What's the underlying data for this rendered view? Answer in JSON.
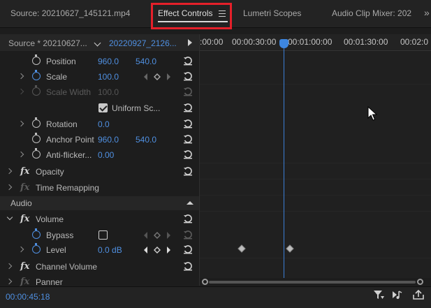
{
  "tabs": {
    "source": "Source: 20210627_145121.mp4",
    "effect_controls": "Effect Controls",
    "lumetri": "Lumetri Scopes",
    "audio_mixer": "Audio Clip Mixer: 202"
  },
  "source_row": {
    "source_label": "Source * 20210627...",
    "sequence_label": "20220927_2126..."
  },
  "ruler": {
    "labels": [
      ":00:00",
      "00:00:30:00",
      "00:01:00:00",
      "00:01:30:00",
      "00:02:0"
    ]
  },
  "properties": {
    "position": {
      "label": "Position",
      "x": "960.0",
      "y": "540.0"
    },
    "scale": {
      "label": "Scale",
      "value": "100.0"
    },
    "scale_width": {
      "label": "Scale Width",
      "value": "100.0"
    },
    "uniform_scale": {
      "label": "Uniform Sc..."
    },
    "rotation": {
      "label": "Rotation",
      "value": "0.0"
    },
    "anchor_point": {
      "label": "Anchor Point",
      "x": "960.0",
      "y": "540.0"
    },
    "anti_flicker": {
      "label": "Anti-flicker...",
      "value": "0.00"
    },
    "opacity": {
      "label": "Opacity"
    },
    "time_remapping": {
      "label": "Time Remapping"
    },
    "audio_section": {
      "label": "Audio"
    },
    "volume": {
      "label": "Volume"
    },
    "bypass": {
      "label": "Bypass"
    },
    "level": {
      "label": "Level",
      "value": "0.0 dB"
    },
    "channel_volume": {
      "label": "Channel Volume"
    },
    "panner": {
      "label": "Panner"
    },
    "fx_symbol": "fx"
  },
  "timecode": "00:00:45:18",
  "colors": {
    "accent": "#4f8fe0",
    "highlight": "#e5202a"
  }
}
